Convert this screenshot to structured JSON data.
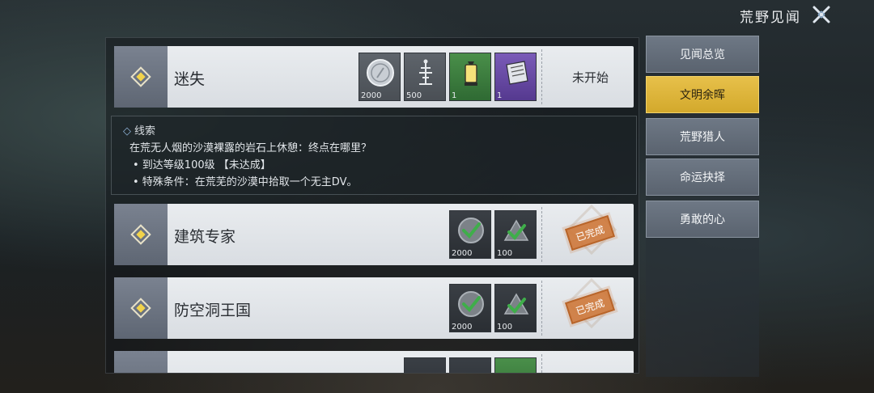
{
  "header": {
    "title": "荒野见闻",
    "close_icon": "close-x-icon"
  },
  "tabs": [
    {
      "label": "见闻总览",
      "active": false
    },
    {
      "label": "文明余晖",
      "active": true
    },
    {
      "label": "荒野猎人",
      "active": false
    },
    {
      "label": "命运抉择",
      "active": false
    },
    {
      "label": "勇敢的心",
      "active": false
    }
  ],
  "cards": [
    {
      "title": "迷失",
      "status": "未开始",
      "rewards": [
        {
          "icon": "silver-coin-icon",
          "qty": "2000"
        },
        {
          "icon": "antenna-icon",
          "qty": "500"
        },
        {
          "icon": "lantern-icon",
          "qty": "1"
        },
        {
          "icon": "book-icon",
          "qty": "1"
        }
      ]
    },
    {
      "title": "建筑专家",
      "status": "已完成",
      "rewards": [
        {
          "icon": "check-coin-icon",
          "qty": "2000"
        },
        {
          "icon": "check-mountain-icon",
          "qty": "100"
        }
      ]
    },
    {
      "title": "防空洞王国",
      "status": "已完成",
      "rewards": [
        {
          "icon": "check-coin-icon",
          "qty": "2000"
        },
        {
          "icon": "check-mountain-icon",
          "qty": "100"
        }
      ]
    }
  ],
  "clue": {
    "heading_mark": "◇",
    "heading": "线索",
    "description": "在荒无人烟的沙漠裸露的岩石上休憩：终点在哪里？",
    "bullet1": "• 到达等级100级 【未达成】",
    "bullet2": "• 特殊条件：在荒芜的沙漠中拾取一个无主DV。"
  },
  "colors": {
    "accent": "#d9ad33",
    "stamp": "#ce783a",
    "card_bg": "#e4e7eb"
  }
}
